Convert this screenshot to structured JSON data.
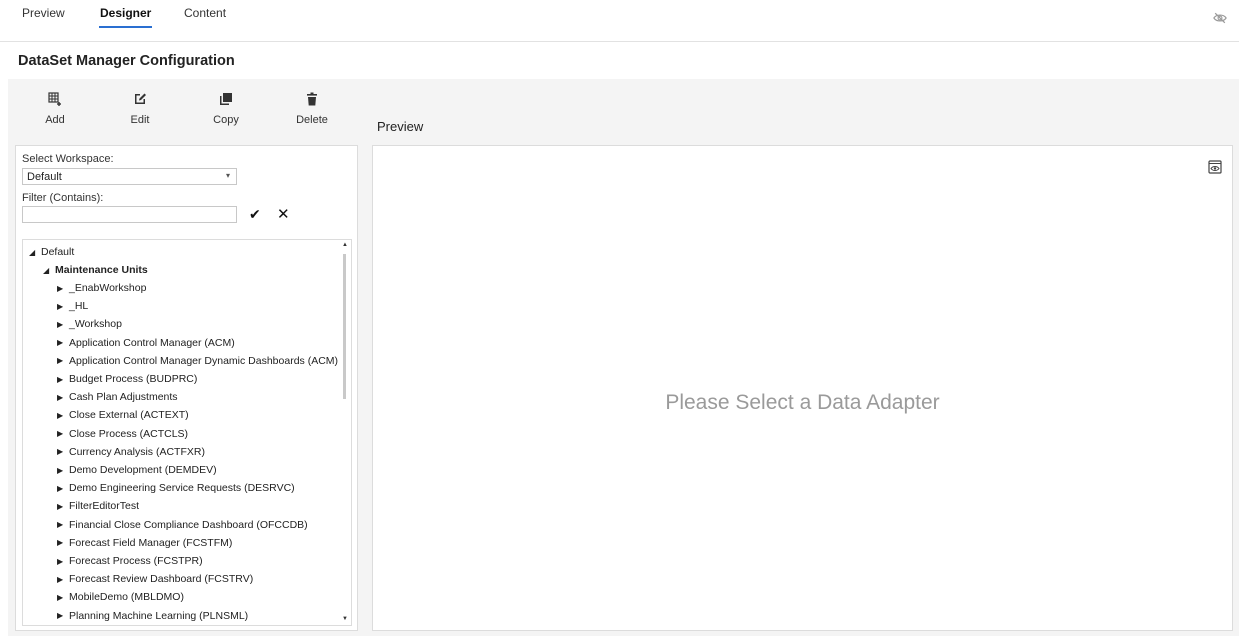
{
  "tabs": [
    {
      "label": "Preview",
      "active": false
    },
    {
      "label": "Designer",
      "active": true
    },
    {
      "label": "Content",
      "active": false
    }
  ],
  "page_title": "DataSet Manager Configuration",
  "toolbar": {
    "add": {
      "label": "Add",
      "icon": "add-table-icon"
    },
    "edit": {
      "label": "Edit",
      "icon": "edit-icon"
    },
    "copy": {
      "label": "Copy",
      "icon": "copy-icon"
    },
    "delete": {
      "label": "Delete",
      "icon": "trash-icon"
    }
  },
  "preview_label": "Preview",
  "workspace": {
    "label": "Select Workspace:",
    "value": "Default"
  },
  "filter": {
    "label": "Filter (Contains):",
    "value": "",
    "apply_icon": "✔",
    "clear_icon": "✕"
  },
  "tree": {
    "root": "Default",
    "group": "Maintenance Units",
    "items": [
      "_EnabWorkshop",
      "_HL",
      "_Workshop",
      "Application Control Manager (ACM)",
      "Application Control Manager Dynamic Dashboards (ACM)",
      "Budget Process (BUDPRC)",
      "Cash Plan Adjustments",
      "Close External (ACTEXT)",
      "Close Process (ACTCLS)",
      "Currency Analysis (ACTFXR)",
      "Demo Development (DEMDEV)",
      "Demo Engineering Service Requests (DESRVC)",
      "FilterEditorTest",
      "Financial Close Compliance Dashboard (OFCCDB)",
      "Forecast Field Manager (FCSTFM)",
      "Forecast Process (FCSTPR)",
      "Forecast Review Dashboard (FCSTRV)",
      "MobileDemo (MBLDMO)",
      "Planning Machine Learning (PLNSML)"
    ]
  },
  "placeholder": "Please Select a Data Adapter",
  "colors": {
    "accent": "#2a6fd1",
    "work_bg": "#f4f4f4",
    "placeholder": "#9a9a9a"
  }
}
